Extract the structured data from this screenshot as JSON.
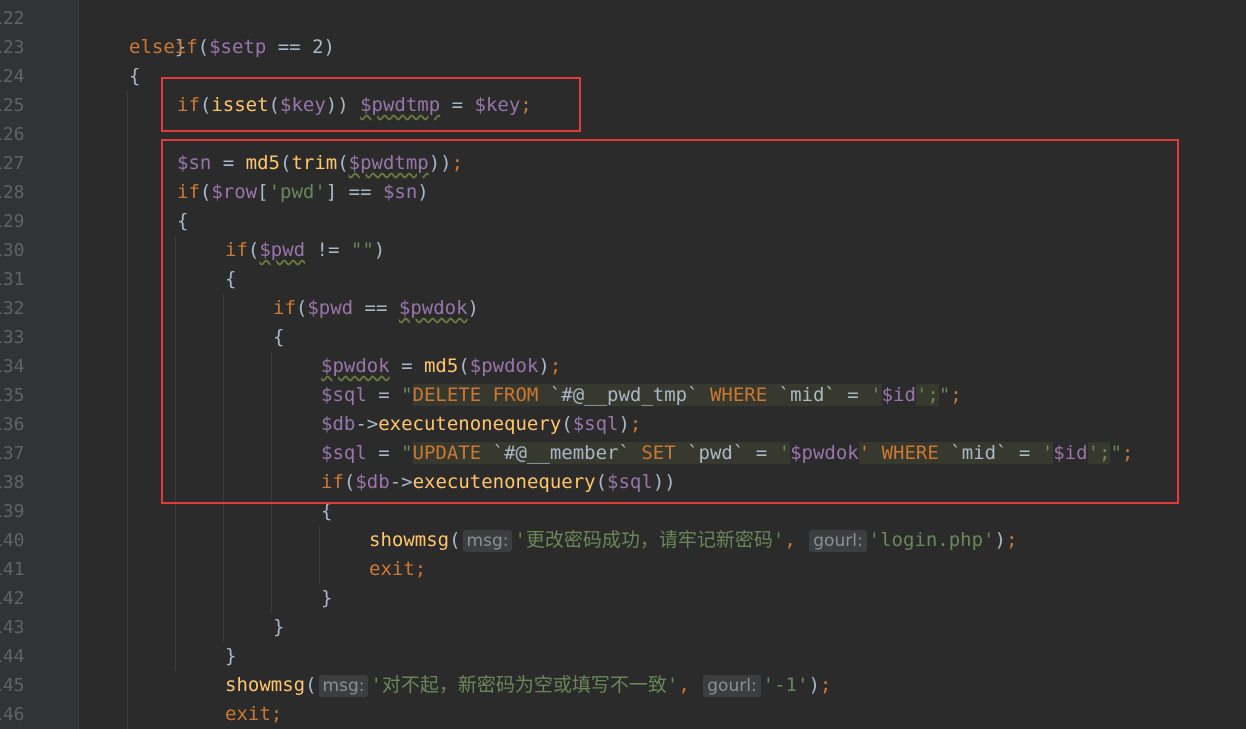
{
  "line_numbers": [
    "122",
    "123",
    "124",
    "125",
    "126",
    "127",
    "128",
    "129",
    "130",
    "131",
    "132",
    "133",
    "134",
    "135",
    "136",
    "137",
    "138",
    "139",
    "140",
    "141",
    "142",
    "143",
    "144",
    "145",
    "146"
  ],
  "code": {
    "l122": {
      "brace": "}"
    },
    "l123": {
      "kw": "elseif",
      "open": "(",
      "var": "$setp",
      "op": " == ",
      "num": "2",
      "close": ")"
    },
    "l124": {
      "brace": "{"
    },
    "l125": {
      "kw": "if",
      "p1": "(",
      "fn": "isset",
      "p2": "(",
      "var1": "$key",
      "p3": ")) ",
      "var2": "$pwdtmp",
      "op": " = ",
      "var3": "$key",
      "semi": ";"
    },
    "l127": {
      "var1": "$sn",
      "op": " = ",
      "fn1": "md5",
      "p1": "(",
      "fn2": "trim",
      "p2": "(",
      "var2": "$pwdtmp",
      "p3": "))",
      "semi": ";"
    },
    "l128": {
      "kw": "if",
      "p1": "(",
      "var1": "$row",
      "b1": "[",
      "str": "'pwd'",
      "b2": "] == ",
      "var2": "$sn",
      "p2": ")"
    },
    "l129": {
      "brace": "{"
    },
    "l130": {
      "kw": "if",
      "p1": "(",
      "var": "$pwd",
      "op": " != ",
      "str": "\"\"",
      "p2": ")"
    },
    "l131": {
      "brace": "{"
    },
    "l132": {
      "kw": "if",
      "p1": "(",
      "var1": "$pwd",
      "op": " == ",
      "var2": "$pwdok",
      "p2": ")"
    },
    "l133": {
      "brace": "{"
    },
    "l134": {
      "var1": "$pwdok",
      "op": " = ",
      "fn": "md5",
      "p1": "(",
      "var2": "$pwdok",
      "p2": ")",
      "semi": ";"
    },
    "l135": {
      "var": "$sql",
      "op": " = ",
      "q1": "\"",
      "sql1": "DELETE FROM ",
      "sql2": "`#@__pwd_tmp`",
      "sql3": " WHERE ",
      "sql4": "`mid`",
      "sql5": " = ",
      "sql6": "'",
      "var2": "$id",
      "sql7": "';",
      "q2": "\"",
      "semi": ";"
    },
    "l136": {
      "var1": "$db",
      "arrow": "->",
      "fn": "executenonequery",
      "p1": "(",
      "var2": "$sql",
      "p2": ")",
      "semi": ";"
    },
    "l137": {
      "var": "$sql",
      "op": " = ",
      "q1": "\"",
      "sql1": "UPDATE ",
      "sql2": "`#@__member`",
      "sql3": " SET ",
      "sql4": "`pwd`",
      "sql5": " = ",
      "sql6": "'",
      "var2": "$pwdok",
      "sql7": "' WHERE ",
      "sql8": "`mid`",
      "sql9": " = ",
      "sql10": "'",
      "var3": "$id",
      "sql11": "';",
      "q2": "\"",
      "semi": ";"
    },
    "l138": {
      "kw": "if",
      "p1": "(",
      "var1": "$db",
      "arrow": "->",
      "fn": "executenonequery",
      "p2": "(",
      "var2": "$sql",
      "p3": "))"
    },
    "l139": {
      "brace": "{"
    },
    "l140": {
      "fn": "showmsg",
      "p1": "(",
      "hint1": "msg:",
      "str1": "'更改密码成功，请牢记新密码'",
      "comma": ",",
      "hint2": "gourl:",
      "str2": "'login.php'",
      "p2": ")",
      "semi": ";"
    },
    "l141": {
      "kw": "exit",
      "semi": ";"
    },
    "l142": {
      "brace": "}"
    },
    "l143": {
      "brace": "}"
    },
    "l144": {
      "brace": "}"
    },
    "l145": {
      "fn": "showmsg",
      "p1": "(",
      "hint1": "msg:",
      "str1": "'对不起，新密码为空或填写不一致'",
      "comma": ",",
      "hint2": "gourl:",
      "str2": "'-1'",
      "p2": ")",
      "semi": ";"
    },
    "l146": {
      "kw": "exit",
      "semi": ";"
    }
  },
  "colors": {
    "background": "#2b2b2b",
    "highlight_box": "#e23b3b",
    "keyword": "#cc7832",
    "variable": "#9876aa",
    "function": "#ffc66d",
    "string": "#6a8759"
  }
}
